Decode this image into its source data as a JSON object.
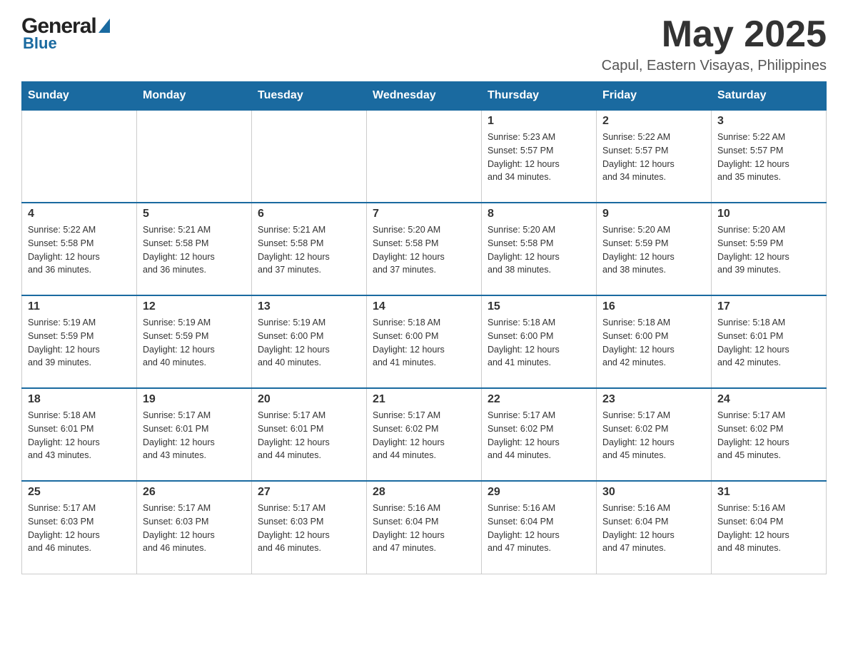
{
  "header": {
    "month_title": "May 2025",
    "location": "Capul, Eastern Visayas, Philippines",
    "logo_general": "General",
    "logo_blue": "Blue"
  },
  "weekdays": [
    "Sunday",
    "Monday",
    "Tuesday",
    "Wednesday",
    "Thursday",
    "Friday",
    "Saturday"
  ],
  "weeks": [
    [
      {
        "day": "",
        "info": ""
      },
      {
        "day": "",
        "info": ""
      },
      {
        "day": "",
        "info": ""
      },
      {
        "day": "",
        "info": ""
      },
      {
        "day": "1",
        "info": "Sunrise: 5:23 AM\nSunset: 5:57 PM\nDaylight: 12 hours\nand 34 minutes."
      },
      {
        "day": "2",
        "info": "Sunrise: 5:22 AM\nSunset: 5:57 PM\nDaylight: 12 hours\nand 34 minutes."
      },
      {
        "day": "3",
        "info": "Sunrise: 5:22 AM\nSunset: 5:57 PM\nDaylight: 12 hours\nand 35 minutes."
      }
    ],
    [
      {
        "day": "4",
        "info": "Sunrise: 5:22 AM\nSunset: 5:58 PM\nDaylight: 12 hours\nand 36 minutes."
      },
      {
        "day": "5",
        "info": "Sunrise: 5:21 AM\nSunset: 5:58 PM\nDaylight: 12 hours\nand 36 minutes."
      },
      {
        "day": "6",
        "info": "Sunrise: 5:21 AM\nSunset: 5:58 PM\nDaylight: 12 hours\nand 37 minutes."
      },
      {
        "day": "7",
        "info": "Sunrise: 5:20 AM\nSunset: 5:58 PM\nDaylight: 12 hours\nand 37 minutes."
      },
      {
        "day": "8",
        "info": "Sunrise: 5:20 AM\nSunset: 5:58 PM\nDaylight: 12 hours\nand 38 minutes."
      },
      {
        "day": "9",
        "info": "Sunrise: 5:20 AM\nSunset: 5:59 PM\nDaylight: 12 hours\nand 38 minutes."
      },
      {
        "day": "10",
        "info": "Sunrise: 5:20 AM\nSunset: 5:59 PM\nDaylight: 12 hours\nand 39 minutes."
      }
    ],
    [
      {
        "day": "11",
        "info": "Sunrise: 5:19 AM\nSunset: 5:59 PM\nDaylight: 12 hours\nand 39 minutes."
      },
      {
        "day": "12",
        "info": "Sunrise: 5:19 AM\nSunset: 5:59 PM\nDaylight: 12 hours\nand 40 minutes."
      },
      {
        "day": "13",
        "info": "Sunrise: 5:19 AM\nSunset: 6:00 PM\nDaylight: 12 hours\nand 40 minutes."
      },
      {
        "day": "14",
        "info": "Sunrise: 5:18 AM\nSunset: 6:00 PM\nDaylight: 12 hours\nand 41 minutes."
      },
      {
        "day": "15",
        "info": "Sunrise: 5:18 AM\nSunset: 6:00 PM\nDaylight: 12 hours\nand 41 minutes."
      },
      {
        "day": "16",
        "info": "Sunrise: 5:18 AM\nSunset: 6:00 PM\nDaylight: 12 hours\nand 42 minutes."
      },
      {
        "day": "17",
        "info": "Sunrise: 5:18 AM\nSunset: 6:01 PM\nDaylight: 12 hours\nand 42 minutes."
      }
    ],
    [
      {
        "day": "18",
        "info": "Sunrise: 5:18 AM\nSunset: 6:01 PM\nDaylight: 12 hours\nand 43 minutes."
      },
      {
        "day": "19",
        "info": "Sunrise: 5:17 AM\nSunset: 6:01 PM\nDaylight: 12 hours\nand 43 minutes."
      },
      {
        "day": "20",
        "info": "Sunrise: 5:17 AM\nSunset: 6:01 PM\nDaylight: 12 hours\nand 44 minutes."
      },
      {
        "day": "21",
        "info": "Sunrise: 5:17 AM\nSunset: 6:02 PM\nDaylight: 12 hours\nand 44 minutes."
      },
      {
        "day": "22",
        "info": "Sunrise: 5:17 AM\nSunset: 6:02 PM\nDaylight: 12 hours\nand 44 minutes."
      },
      {
        "day": "23",
        "info": "Sunrise: 5:17 AM\nSunset: 6:02 PM\nDaylight: 12 hours\nand 45 minutes."
      },
      {
        "day": "24",
        "info": "Sunrise: 5:17 AM\nSunset: 6:02 PM\nDaylight: 12 hours\nand 45 minutes."
      }
    ],
    [
      {
        "day": "25",
        "info": "Sunrise: 5:17 AM\nSunset: 6:03 PM\nDaylight: 12 hours\nand 46 minutes."
      },
      {
        "day": "26",
        "info": "Sunrise: 5:17 AM\nSunset: 6:03 PM\nDaylight: 12 hours\nand 46 minutes."
      },
      {
        "day": "27",
        "info": "Sunrise: 5:17 AM\nSunset: 6:03 PM\nDaylight: 12 hours\nand 46 minutes."
      },
      {
        "day": "28",
        "info": "Sunrise: 5:16 AM\nSunset: 6:04 PM\nDaylight: 12 hours\nand 47 minutes."
      },
      {
        "day": "29",
        "info": "Sunrise: 5:16 AM\nSunset: 6:04 PM\nDaylight: 12 hours\nand 47 minutes."
      },
      {
        "day": "30",
        "info": "Sunrise: 5:16 AM\nSunset: 6:04 PM\nDaylight: 12 hours\nand 47 minutes."
      },
      {
        "day": "31",
        "info": "Sunrise: 5:16 AM\nSunset: 6:04 PM\nDaylight: 12 hours\nand 48 minutes."
      }
    ]
  ]
}
